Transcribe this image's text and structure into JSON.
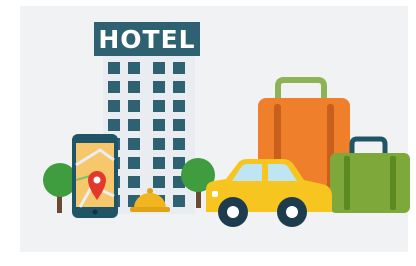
{
  "hotel_sign": {
    "text": "HOTEL"
  },
  "colors": {
    "panel": "#f1f2f4",
    "sign": "#2e6273",
    "sign_text": "#ffffff",
    "building": "#e9ecf1",
    "window": "#2e6273",
    "tree_leaf": "#3f9c3f",
    "tree_trunk": "#6b4a33",
    "phone_body": "#1f5566",
    "map": "#f6c86b",
    "map_pin": "#e3392d",
    "bell": "#f0b51f",
    "car_body": "#f7c51f",
    "car_window": "#bfe4f2",
    "wheel": "#1f3c4f",
    "orange_suitcase": "#f07f2b",
    "green_suitcase": "#7fa83a",
    "handle": "#c85f1c"
  },
  "icons": [
    "hotel-building",
    "smartphone-map-icon",
    "map-pin-icon",
    "tree-icon",
    "reception-bell-icon",
    "taxi-car-icon",
    "suitcase-icon"
  ]
}
